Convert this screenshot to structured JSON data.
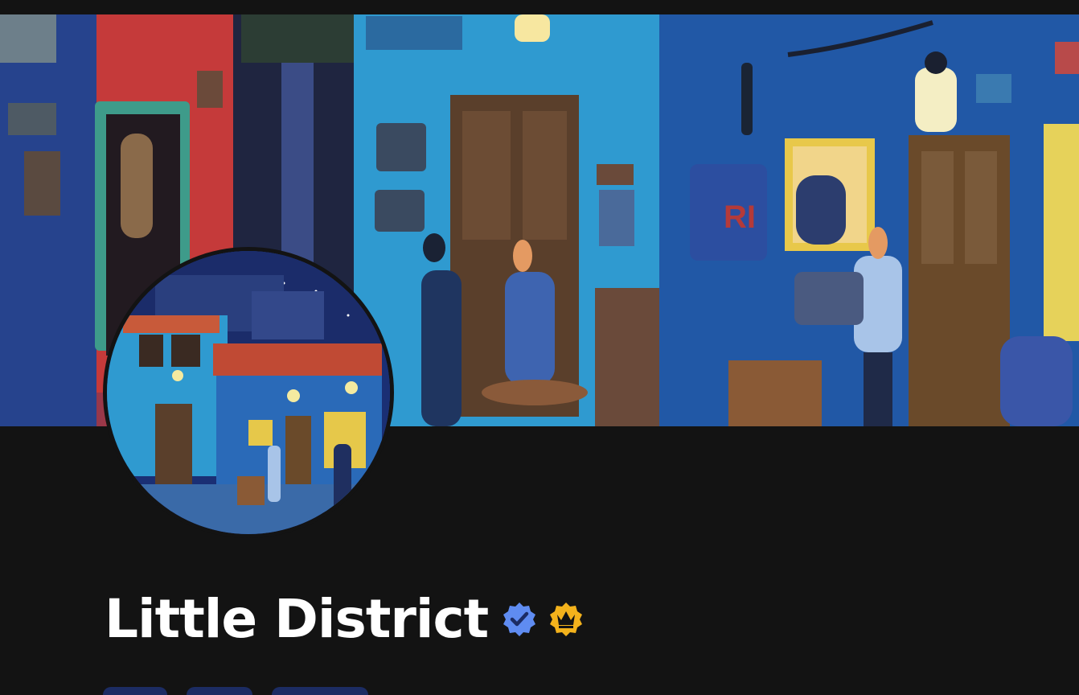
{
  "profile": {
    "name": "Little District",
    "verified_icon": "verified-badge-icon",
    "verified_color": "#5f8cf1",
    "crown_icon": "crown-badge-icon",
    "crown_color": "#f3b21c"
  },
  "banner": {
    "description_icon": "banner-artwork"
  },
  "avatar": {
    "icon": "avatar-artwork"
  },
  "tabs": [
    {
      "label": ""
    },
    {
      "label": ""
    },
    {
      "label": ""
    }
  ],
  "colors": {
    "background": "#131313",
    "chip": "#1c2c63"
  }
}
